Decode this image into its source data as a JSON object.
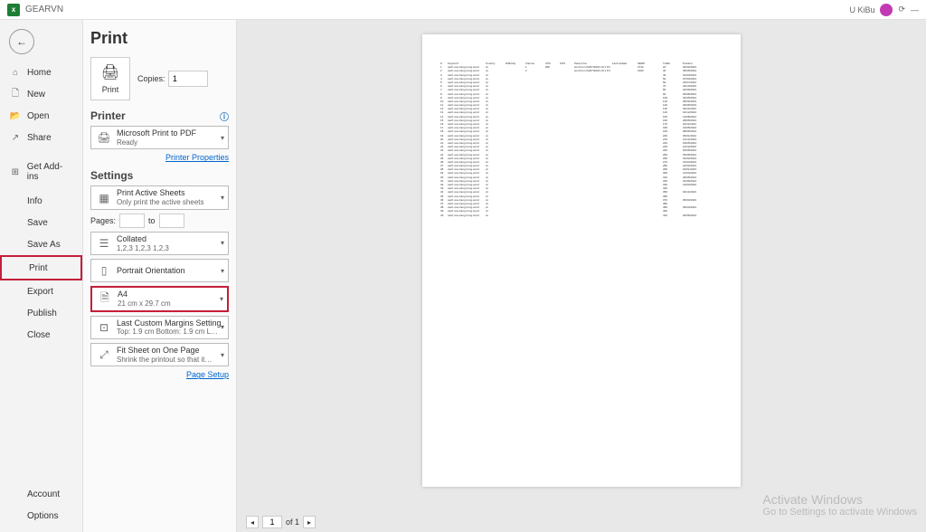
{
  "titlebar": {
    "filename": "GEARVN",
    "user": "U KiBu"
  },
  "sidebar": {
    "home": "Home",
    "new": "New",
    "open": "Open",
    "share": "Share",
    "addins": "Get Add-ins",
    "info": "Info",
    "save": "Save",
    "saveas": "Save As",
    "print": "Print",
    "export": "Export",
    "publish": "Publish",
    "close": "Close",
    "account": "Account",
    "options": "Options"
  },
  "print": {
    "title": "Print",
    "print_btn": "Print",
    "copies_label": "Copies:",
    "copies_value": "1",
    "printer_heading": "Printer",
    "printer_name": "Microsoft Print to PDF",
    "printer_status": "Ready",
    "printer_properties": "Printer Properties",
    "settings_heading": "Settings",
    "active_sheets": {
      "t1": "Print Active Sheets",
      "t2": "Only print the active sheets"
    },
    "pages_label": "Pages:",
    "pages_to": "to",
    "collated": {
      "t1": "Collated",
      "t2": "1,2,3   1,2,3   1,2,3"
    },
    "orientation": "Portrait Orientation",
    "paper": {
      "t1": "A4",
      "t2": "21 cm x 29.7 cm"
    },
    "margins": {
      "t1": "Last Custom Margins Setting",
      "t2": "Top: 1.9 cm  Bottom: 1.9 cm  L…"
    },
    "scaling": {
      "t1": "Fit Sheet on One Page",
      "t2": "Shrink the printout so that it…"
    },
    "page_setup": "Page Setup"
  },
  "nav": {
    "current": "1",
    "total": "of 1"
  },
  "watermark": {
    "w1": "Activate Windows",
    "w2": "Go to Settings to activate Windows"
  }
}
